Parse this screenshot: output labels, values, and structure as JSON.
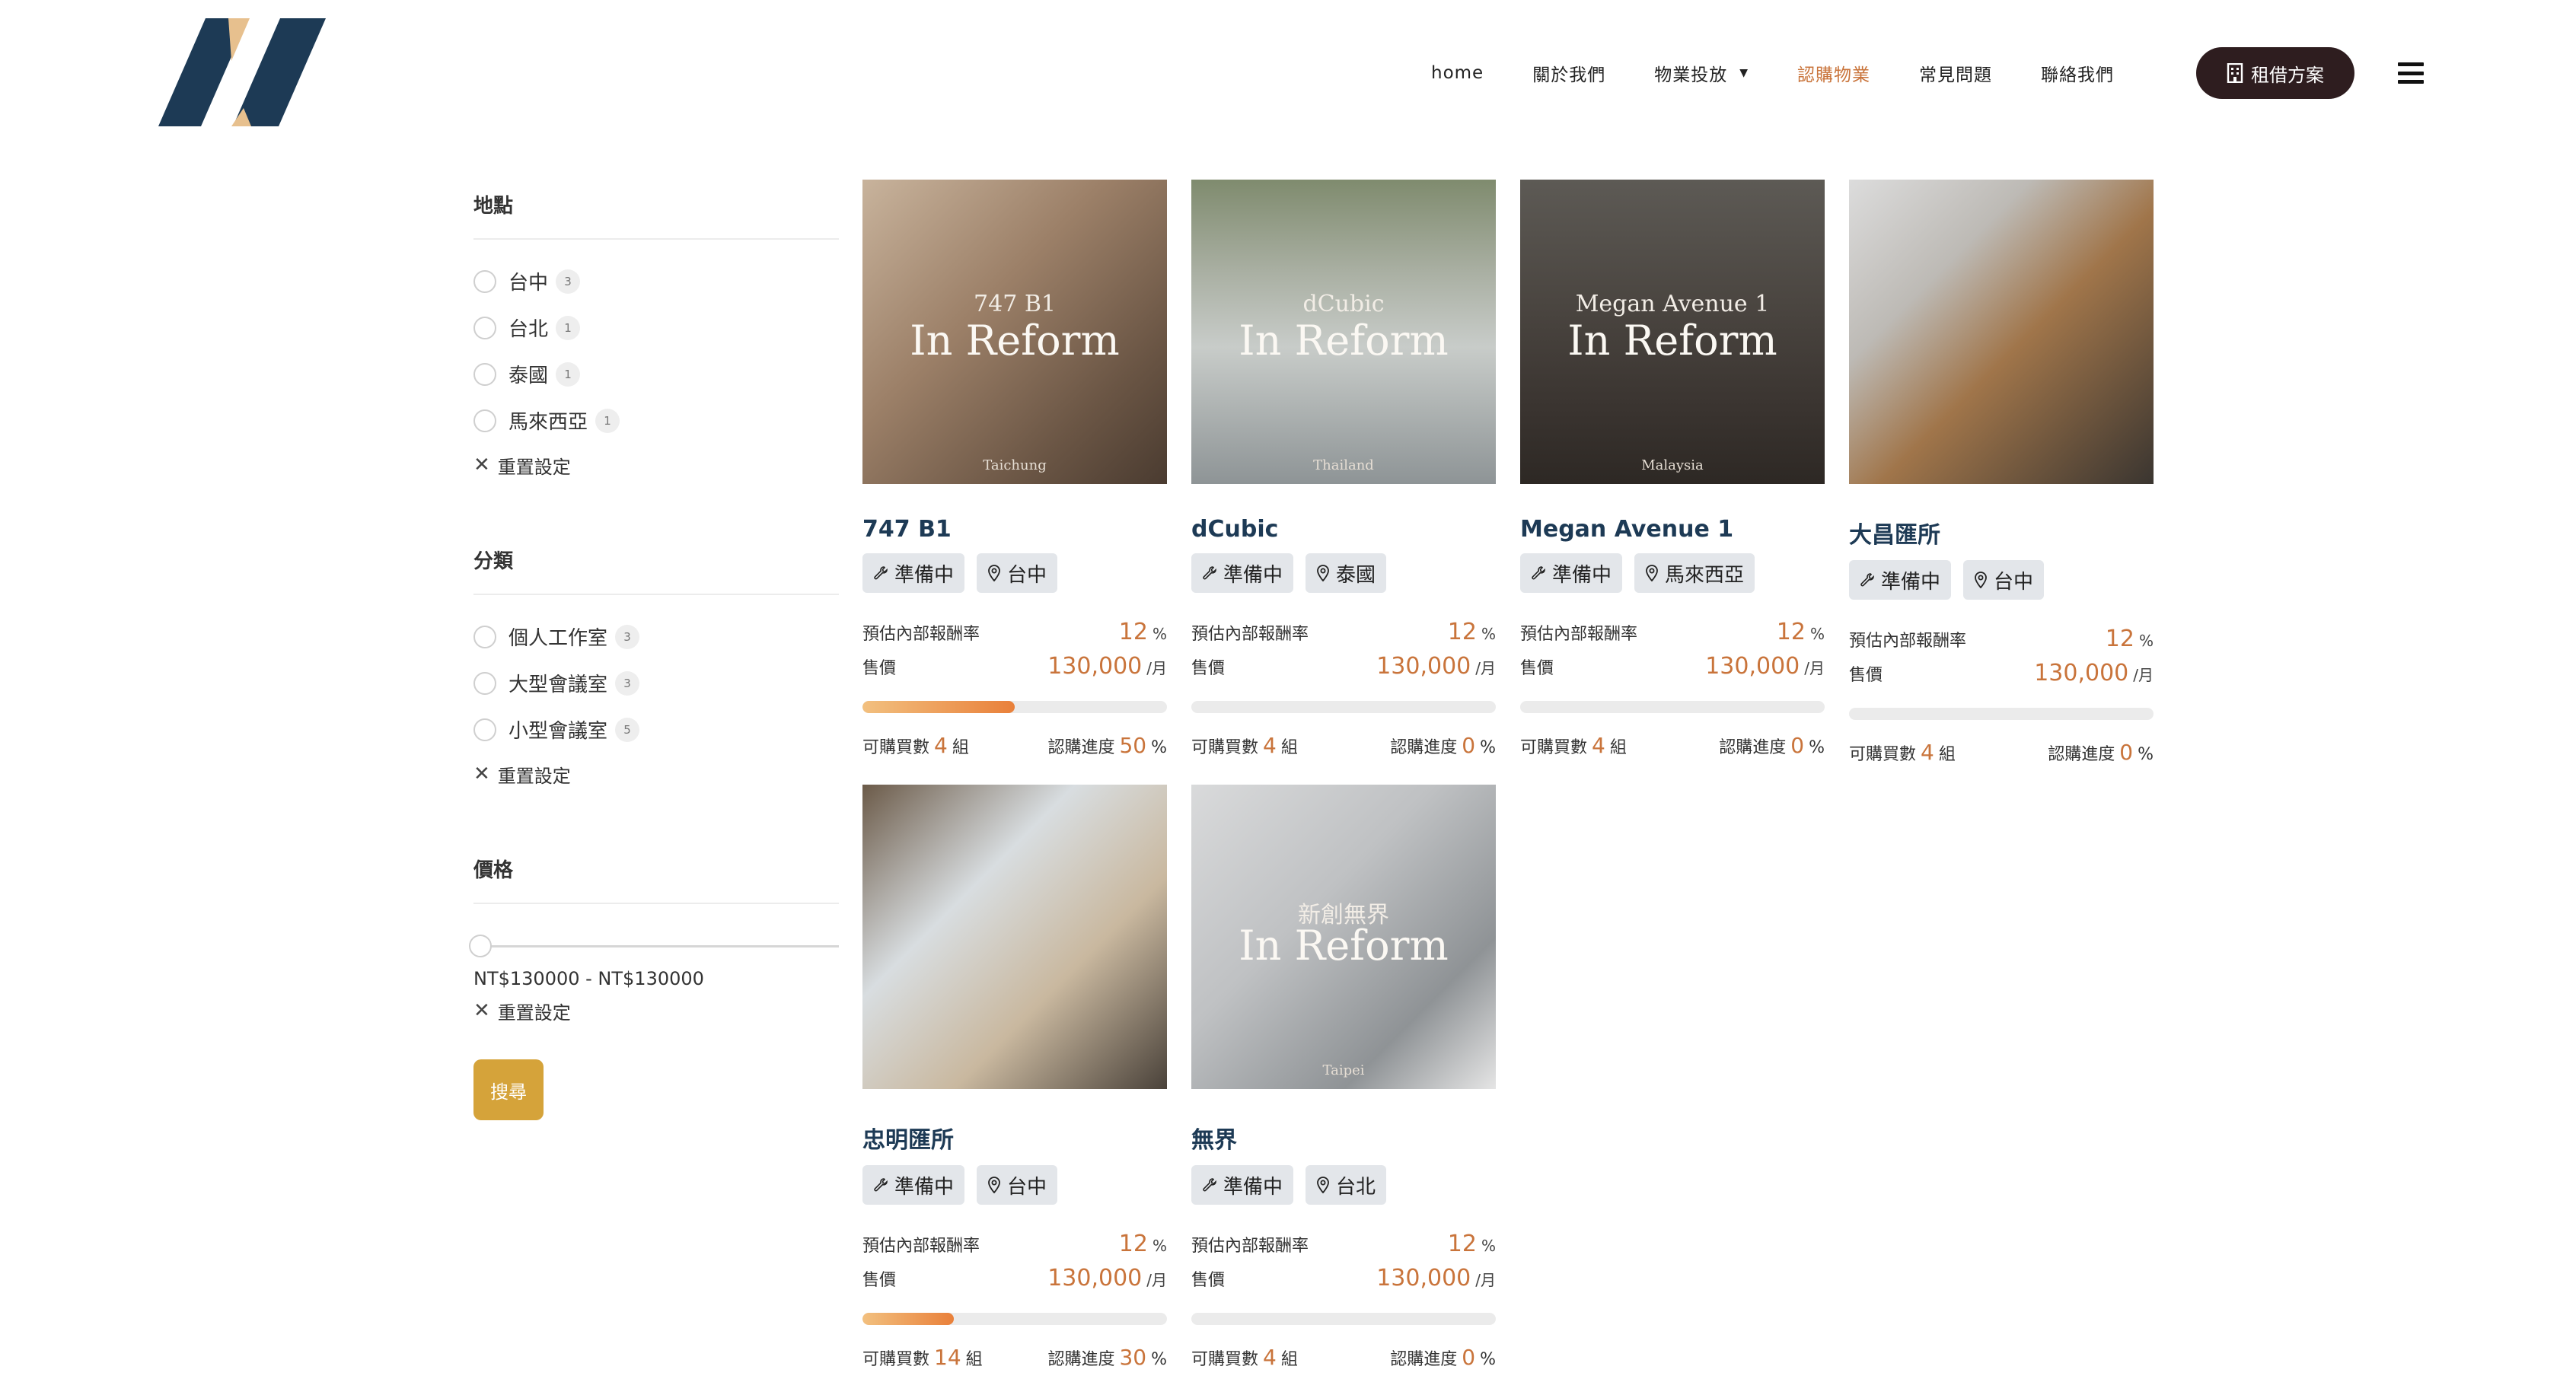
{
  "nav": {
    "items": [
      "home",
      "關於我們",
      "物業投放",
      "認購物業",
      "常見問題",
      "聯絡我們"
    ],
    "rent_button": "租借方案"
  },
  "filters": {
    "location": {
      "title": "地點",
      "options": [
        {
          "label": "台中",
          "count": "3"
        },
        {
          "label": "台北",
          "count": "1"
        },
        {
          "label": "泰國",
          "count": "1"
        },
        {
          "label": "馬來西亞",
          "count": "1"
        }
      ],
      "reset": "重置設定"
    },
    "category": {
      "title": "分類",
      "options": [
        {
          "label": "個人工作室",
          "count": "3"
        },
        {
          "label": "大型會議室",
          "count": "3"
        },
        {
          "label": "小型會議室",
          "count": "5"
        }
      ],
      "reset": "重置設定"
    },
    "price": {
      "title": "價格",
      "range": "NT$130000 - NT$130000",
      "reset": "重置設定"
    },
    "search_button": "搜尋"
  },
  "labels": {
    "irr": "預估內部報酬率",
    "price": "售價",
    "available": "可購買數",
    "unit_group": "組",
    "progress": "認購進度",
    "percent": "%",
    "per_month": "/月"
  },
  "cards": [
    {
      "name": "747 B1",
      "status": "準備中",
      "location": "台中",
      "img_top": "747 B1",
      "img_main": "In Reform",
      "img_bottom": "Taichung",
      "irr": "12",
      "price": "130,000",
      "available": "4",
      "progress": "50",
      "progress_value": 0.5
    },
    {
      "name": "dCubic",
      "status": "準備中",
      "location": "泰國",
      "img_top": "dCubic",
      "img_main": "In Reform",
      "img_bottom": "Thailand",
      "irr": "12",
      "price": "130,000",
      "available": "4",
      "progress": "0",
      "progress_value": 0
    },
    {
      "name": "Megan Avenue 1",
      "status": "準備中",
      "location": "馬來西亞",
      "img_top": "Megan Avenue 1",
      "img_main": "In Reform",
      "img_bottom": "Malaysia",
      "irr": "12",
      "price": "130,000",
      "available": "4",
      "progress": "0",
      "progress_value": 0
    },
    {
      "name": "大昌匯所",
      "status": "準備中",
      "location": "台中",
      "img_top": "",
      "img_main": "",
      "img_bottom": "",
      "irr": "12",
      "price": "130,000",
      "available": "4",
      "progress": "0",
      "progress_value": 0
    },
    {
      "name": "忠明匯所",
      "status": "準備中",
      "location": "台中",
      "img_top": "",
      "img_main": "",
      "img_bottom": "",
      "irr": "12",
      "price": "130,000",
      "available": "14",
      "progress": "30",
      "progress_value": 0.3
    },
    {
      "name": "無界",
      "status": "準備中",
      "location": "台北",
      "img_top": "新創無界",
      "img_main": "In Reform",
      "img_bottom": "Taipei",
      "irr": "12",
      "price": "130,000",
      "available": "4",
      "progress": "0",
      "progress_value": 0
    }
  ],
  "colors": {
    "accent": "#c9743b",
    "brand_navy": "#1d3a55",
    "brand_dark": "#2e1d1f",
    "search_gold": "#d5a33a"
  }
}
